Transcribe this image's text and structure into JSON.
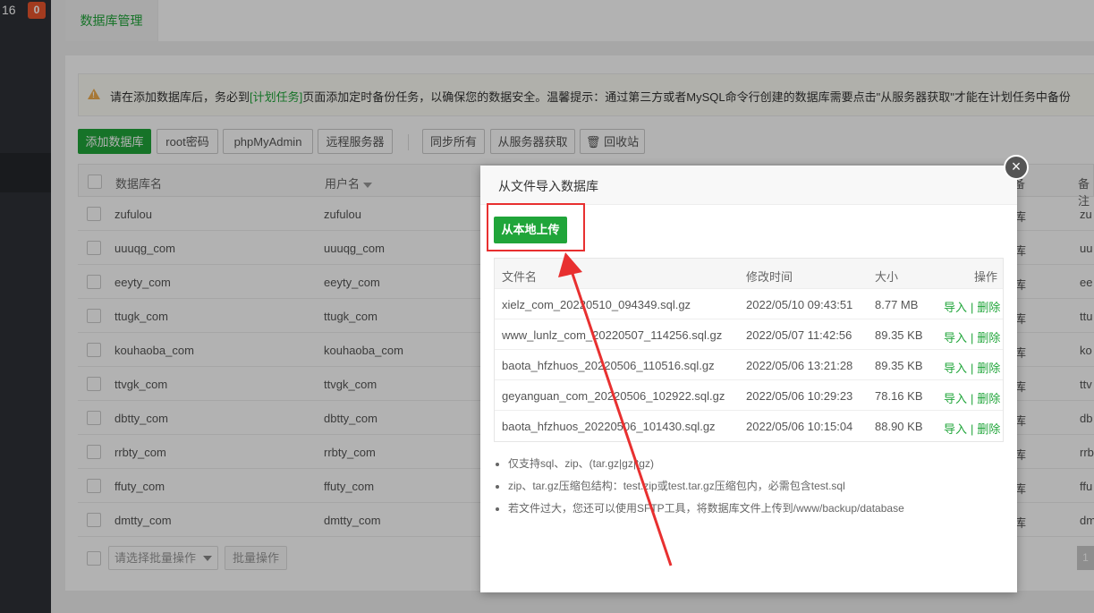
{
  "sidebar": {
    "top_number": "16",
    "badge_count": "0"
  },
  "tabs": [
    {
      "label": "数据库管理"
    }
  ],
  "notice": {
    "part1": "请在添加数据库后，务必到",
    "link": "[计划任务]",
    "part2": "页面添加定时备份任务，以确保您的数据安全。温馨提示：通过第三方或者MySQL命令行创建的数据库需要点击\"从服务器获取\"才能在计划任务中备份"
  },
  "toolbar": {
    "add_db": "添加数据库",
    "root_pwd": "root密码",
    "phpmyadmin": "phpMyAdmin",
    "remote": "远程服务器",
    "sync_all": "同步所有",
    "fetch_server": "从服务器获取",
    "recycle": "回收站"
  },
  "table": {
    "headers": {
      "dbname": "数据库名",
      "username": "用户名",
      "col_right_partial": "备注",
      "col_mid_partial": "备"
    },
    "rows": [
      {
        "dbname": "zufulou",
        "username": "zufulou",
        "partial1": "库",
        "partial2": "zu"
      },
      {
        "dbname": "uuuqg_com",
        "username": "uuuqg_com",
        "partial1": "库",
        "partial2": "uu"
      },
      {
        "dbname": "eeyty_com",
        "username": "eeyty_com",
        "partial1": "库",
        "partial2": "ee"
      },
      {
        "dbname": "ttugk_com",
        "username": "ttugk_com",
        "partial1": "库",
        "partial2": "ttu"
      },
      {
        "dbname": "kouhaoba_com",
        "username": "kouhaoba_com",
        "partial1": "库",
        "partial2": "ko"
      },
      {
        "dbname": "ttvgk_com",
        "username": "ttvgk_com",
        "partial1": "库",
        "partial2": "ttv"
      },
      {
        "dbname": "dbtty_com",
        "username": "dbtty_com",
        "partial1": "库",
        "partial2": "db"
      },
      {
        "dbname": "rrbty_com",
        "username": "rrbty_com",
        "partial1": "库",
        "partial2": "rrb"
      },
      {
        "dbname": "ffuty_com",
        "username": "ffuty_com",
        "partial1": "库",
        "partial2": "ffu"
      },
      {
        "dbname": "dmtty_com",
        "username": "dmtty_com",
        "partial1": "库",
        "partial2": "dm"
      }
    ]
  },
  "batch": {
    "placeholder": "请选择批量操作",
    "button": "批量操作"
  },
  "pager": {
    "current": "1"
  },
  "modal": {
    "title": "从文件导入数据库",
    "upload_button": "从本地上传",
    "close_symbol": "×",
    "columns": {
      "filename": "文件名",
      "mtime": "修改时间",
      "size": "大小",
      "ops": "操作"
    },
    "files": [
      {
        "name": "xielz_com_20220510_094349.sql.gz",
        "mtime": "2022/05/10 09:43:51",
        "size": "8.77 MB"
      },
      {
        "name": "www_lunlz_com_20220507_114256.sql.gz",
        "mtime": "2022/05/07 11:42:56",
        "size": "89.35 KB"
      },
      {
        "name": "baota_hfzhuos_20220506_110516.sql.gz",
        "mtime": "2022/05/06 13:21:28",
        "size": "89.35 KB"
      },
      {
        "name": "geyanguan_com_20220506_102922.sql.gz",
        "mtime": "2022/05/06 10:29:23",
        "size": "78.16 KB"
      },
      {
        "name": "baota_hfzhuos_20220506_101430.sql.gz",
        "mtime": "2022/05/06 10:15:04",
        "size": "88.90 KB"
      }
    ],
    "action_import": "导入",
    "action_delete": "删除",
    "action_sep": "|",
    "tips": [
      "仅支持sql、zip、(tar.gz|gz|tgz)",
      "zip、tar.gz压缩包结构：test.zip或test.tar.gz压缩包内，必需包含test.sql",
      "若文件过大，您还可以使用SFTP工具，将数据库文件上传到/www/backup/database"
    ]
  },
  "colors": {
    "accent": "#20a53a",
    "annotation": "#e83030"
  }
}
